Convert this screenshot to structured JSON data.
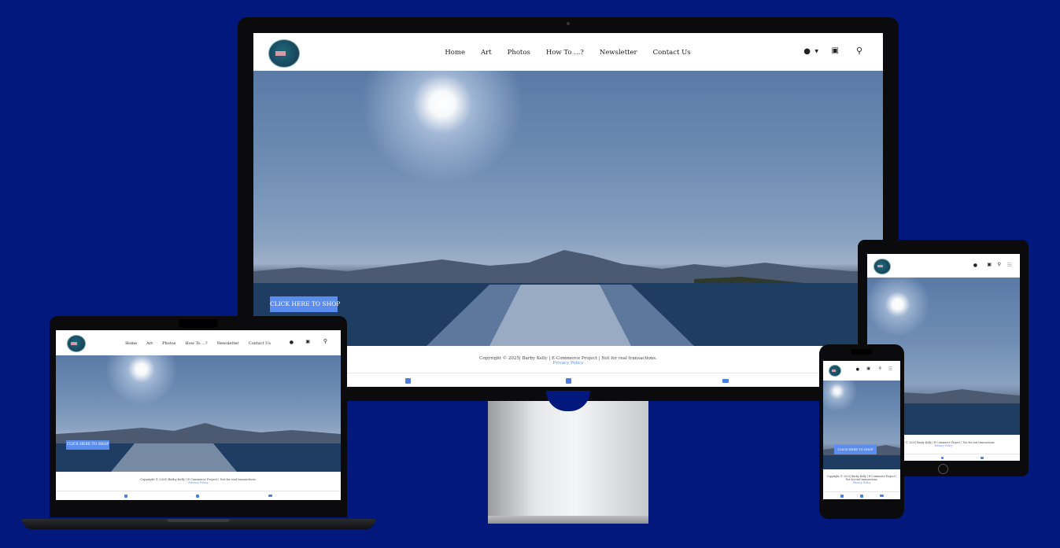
{
  "nav": {
    "items": [
      "Home",
      "Art",
      "Photos",
      "How To ...?",
      "Newsletter",
      "Contact Us"
    ]
  },
  "hero": {
    "shop_button": "CLICK HERE TO SHOP"
  },
  "footer": {
    "copyright": "Copyright © 2025| Barby Kelly | E-Commerce Project | Not for real transactions.",
    "copyright_short": "Copyright © 2025| Barby Kelly | E-Commerce Project | Not for real transactions.",
    "privacy": "Privacy Policy"
  },
  "icons": {
    "account": "user-icon",
    "caret": "caret-down-icon",
    "cart": "cart-icon",
    "search": "search-icon",
    "menu": "hamburger-icon",
    "social": [
      "facebook-icon",
      "x-icon",
      "youtube-icon"
    ]
  },
  "colors": {
    "background": "#02187d",
    "accent": "#5b8def",
    "nav_bg": "#ffffff"
  }
}
